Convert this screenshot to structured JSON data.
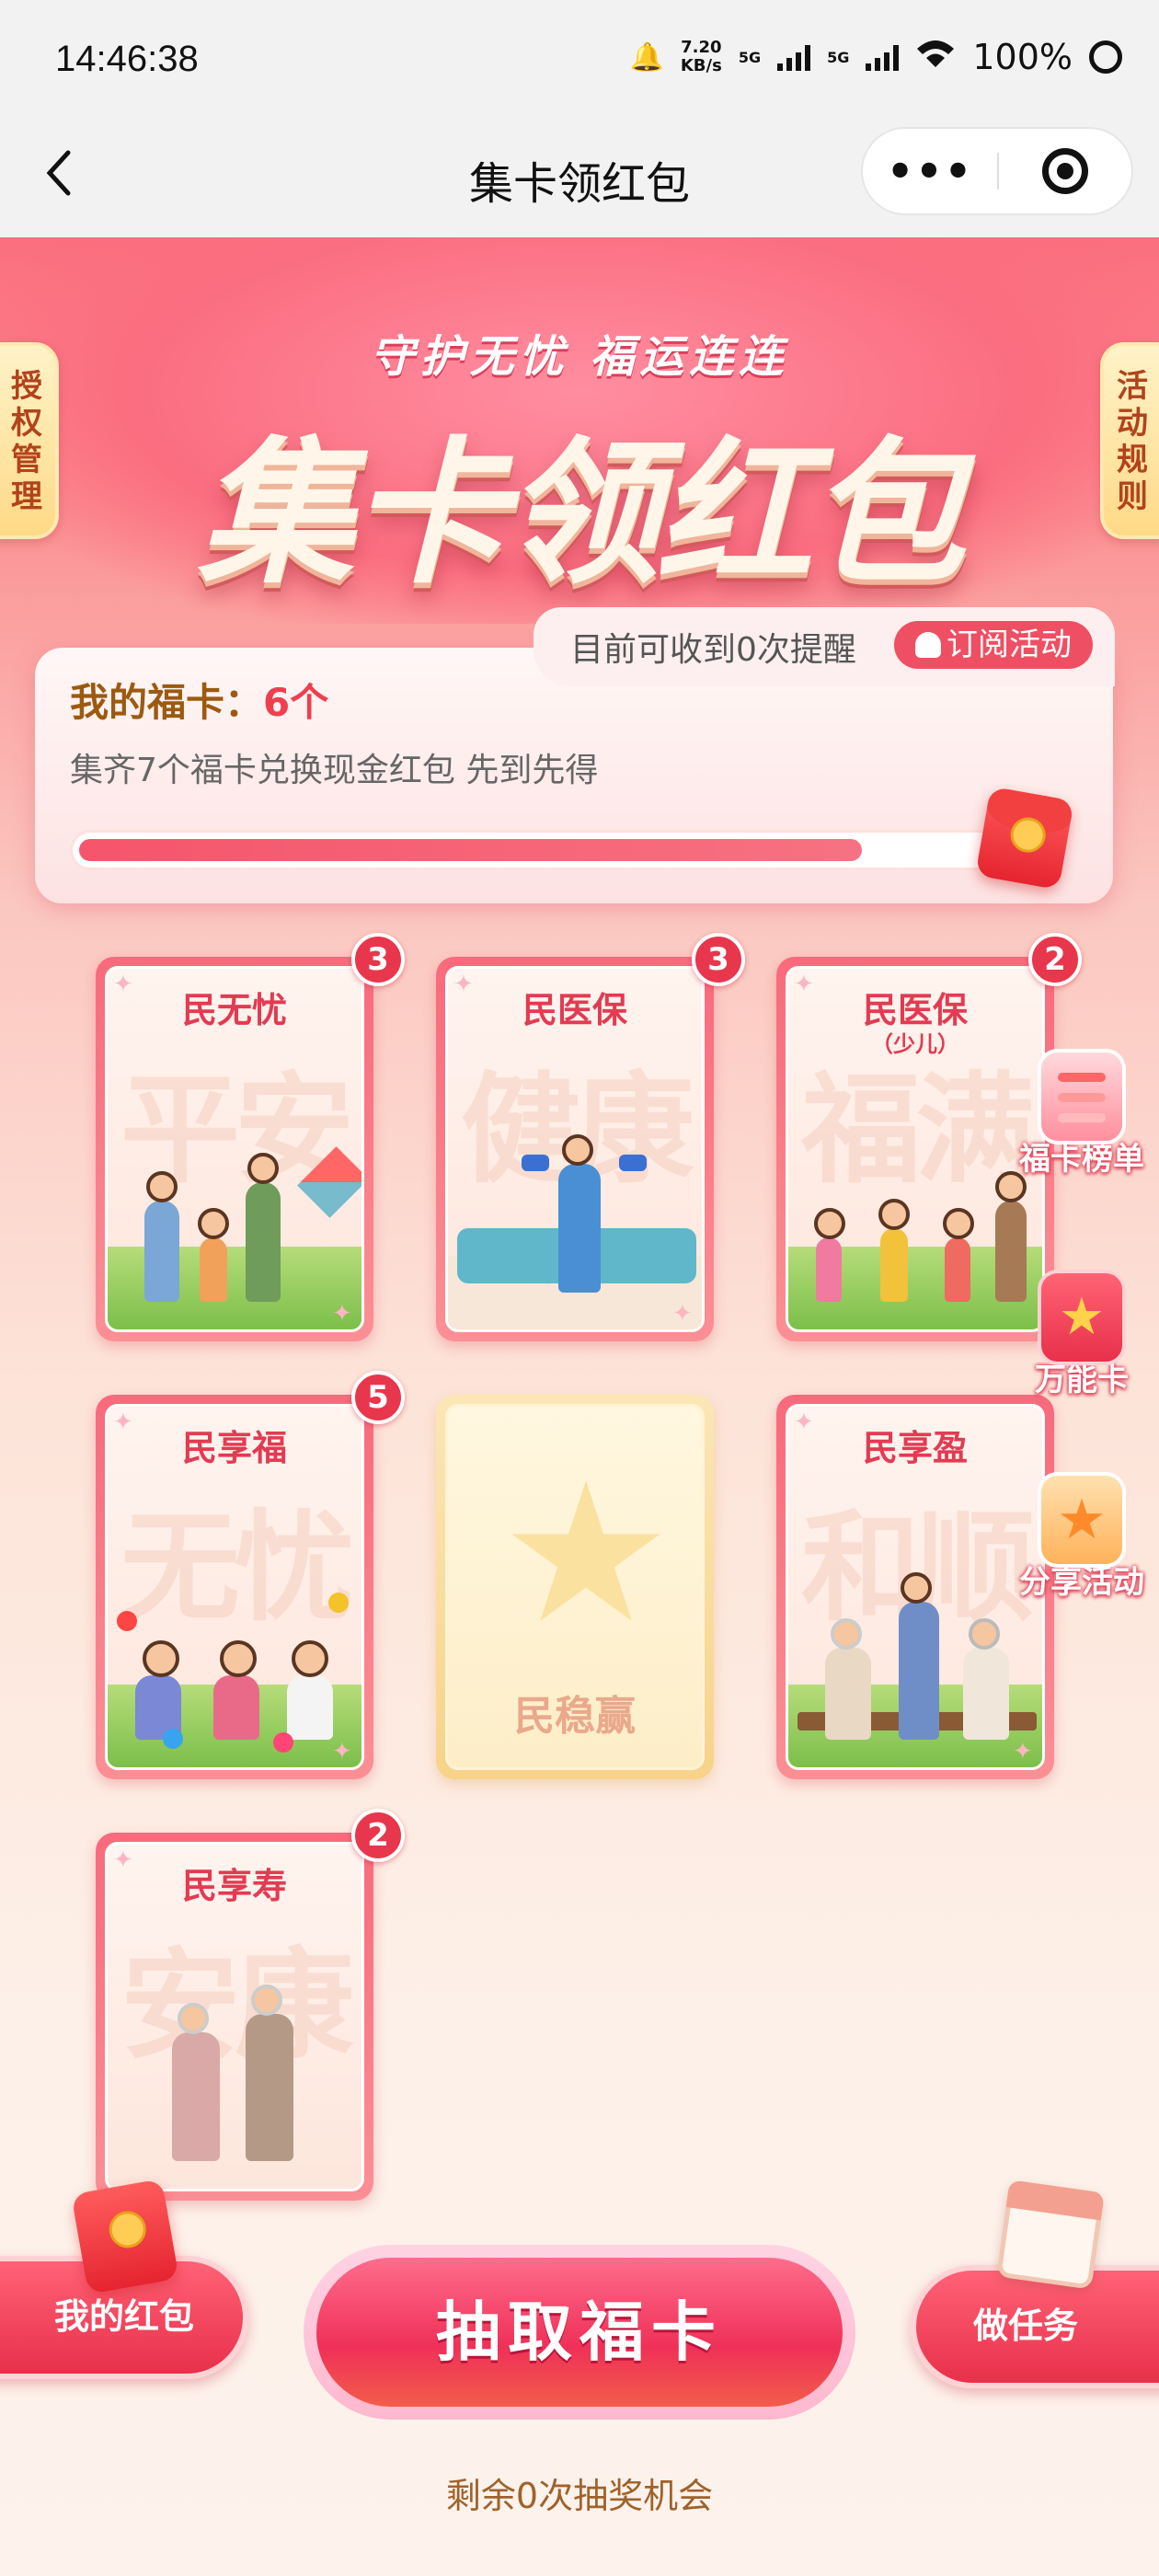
{
  "status_bar": {
    "time": "14:46:38",
    "net_speed_value": "7.20",
    "net_speed_unit": "KB/s",
    "sim1": "5G",
    "sim2": "5G",
    "battery": "100%"
  },
  "nav": {
    "back_icon": "chevron-left-icon",
    "title": "集卡领红包",
    "more_icon": "more-dots-icon",
    "close_icon": "target-circle-icon"
  },
  "hero": {
    "slogan": "守护无忧  福运连连",
    "title": "集卡领红包",
    "left_tag": "授权管理",
    "right_tag": "活动规则"
  },
  "reminder": {
    "text": "目前可收到0次提醒",
    "subscribe_label": "订阅活动"
  },
  "fuka": {
    "label": "我的福卡：",
    "count": "6个",
    "description": "集齐7个福卡兑换现金红包 先到先得",
    "progress": 0.86
  },
  "cards": [
    {
      "name": "民无忧",
      "sub": "",
      "watermark": "平安",
      "count": "3"
    },
    {
      "name": "民医保",
      "sub": "",
      "watermark": "健康",
      "count": "3"
    },
    {
      "name": "民医保",
      "sub": "（少儿）",
      "watermark": "福满",
      "count": "2"
    },
    {
      "name": "民享福",
      "sub": "",
      "watermark": "无忧",
      "count": "5"
    },
    {
      "name": "民稳赢",
      "sub": "",
      "watermark": "",
      "count": ""
    },
    {
      "name": "民享盈",
      "sub": "",
      "watermark": "和顺",
      "count": ""
    },
    {
      "name": "民享寿",
      "sub": "",
      "watermark": "安康",
      "count": "2"
    }
  ],
  "side_widgets": [
    {
      "label": "福卡榜单",
      "icon": "ranking-list-icon"
    },
    {
      "label": "万能卡",
      "icon": "wildcard-star-card-icon"
    },
    {
      "label": "分享活动",
      "icon": "share-star-icon"
    }
  ],
  "bottom": {
    "my_red_packet": "我的红包",
    "draw_button": "抽取福卡",
    "tasks": "做任务",
    "remaining": "剩余0次抽奖机会"
  },
  "colors": {
    "primary_red": "#e8364c",
    "gold_text": "#9c5a10",
    "bg_pink": "#fb6e7e"
  }
}
